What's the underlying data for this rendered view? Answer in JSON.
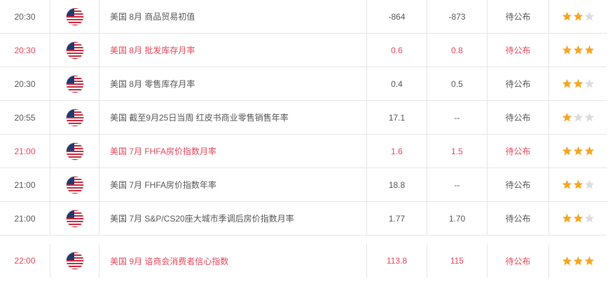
{
  "colors": {
    "highlight": "#e6455b",
    "normal": "#555555",
    "star_on": "#f5a623",
    "star_off": "#dcdcdc"
  },
  "icons": {
    "flag": "us-flag-icon",
    "star": "star-icon"
  },
  "rows": [
    {
      "time": "20:30",
      "event": "美国 8月 商品贸易初值",
      "previous": "-864",
      "forecast": "-873",
      "actual": "待公布",
      "importance": 2,
      "highlight": false
    },
    {
      "time": "20:30",
      "event": "美国 8月 批发库存月率",
      "previous": "0.6",
      "forecast": "0.8",
      "actual": "待公布",
      "importance": 3,
      "highlight": true
    },
    {
      "time": "20:30",
      "event": "美国 8月 零售库存月率",
      "previous": "0.4",
      "forecast": "0.5",
      "actual": "待公布",
      "importance": 2,
      "highlight": false
    },
    {
      "time": "20:55",
      "event": "美国 截至9月25日当周 红皮书商业零售销售年率",
      "previous": "17.1",
      "forecast": "--",
      "actual": "待公布",
      "importance": 1,
      "highlight": false
    },
    {
      "time": "21:00",
      "event": "美国 7月 FHFA房价指数月率",
      "previous": "1.6",
      "forecast": "1.5",
      "actual": "待公布",
      "importance": 3,
      "highlight": true
    },
    {
      "time": "21:00",
      "event": "美国 7月 FHFA房价指数年率",
      "previous": "18.8",
      "forecast": "--",
      "actual": "待公布",
      "importance": 2,
      "highlight": false
    },
    {
      "time": "21:00",
      "event": "美国 7月 S&P/CS20座大城市季调后房价指数月率",
      "previous": "1.77",
      "forecast": "1.70",
      "actual": "待公布",
      "importance": 2,
      "highlight": false
    },
    {
      "time": "22:00",
      "event": "美国 9月 谘商会消费者信心指数",
      "previous": "113.8",
      "forecast": "115",
      "actual": "待公布",
      "importance": 3,
      "highlight": true
    }
  ]
}
